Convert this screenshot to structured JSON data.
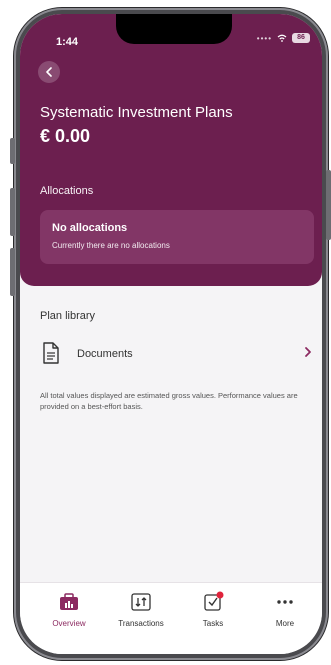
{
  "status_bar": {
    "time": "1:44",
    "battery": "86"
  },
  "header": {
    "title": "Systematic Investment Plans",
    "amount": "€ 0.00",
    "allocations_label": "Allocations",
    "allocations_card": {
      "title": "No allocations",
      "subtitle": "Currently there are no allocations"
    }
  },
  "plan_library": {
    "heading": "Plan library",
    "items": [
      {
        "label": "Documents",
        "icon": "document-icon"
      }
    ],
    "disclaimer": "All total values displayed are estimated gross values. Performance values are provided on a best-effort basis."
  },
  "tabbar": {
    "tabs": [
      {
        "label": "Overview",
        "icon": "briefcase-chart-icon",
        "active": true
      },
      {
        "label": "Transactions",
        "icon": "transfer-icon",
        "active": false
      },
      {
        "label": "Tasks",
        "icon": "tasks-checkbox-icon",
        "active": false,
        "badge": true
      },
      {
        "label": "More",
        "icon": "more-dots-icon",
        "active": false
      }
    ]
  },
  "colors": {
    "brand": "#6c1f4f",
    "accent": "#8c2a61",
    "badge": "#e0233b"
  }
}
